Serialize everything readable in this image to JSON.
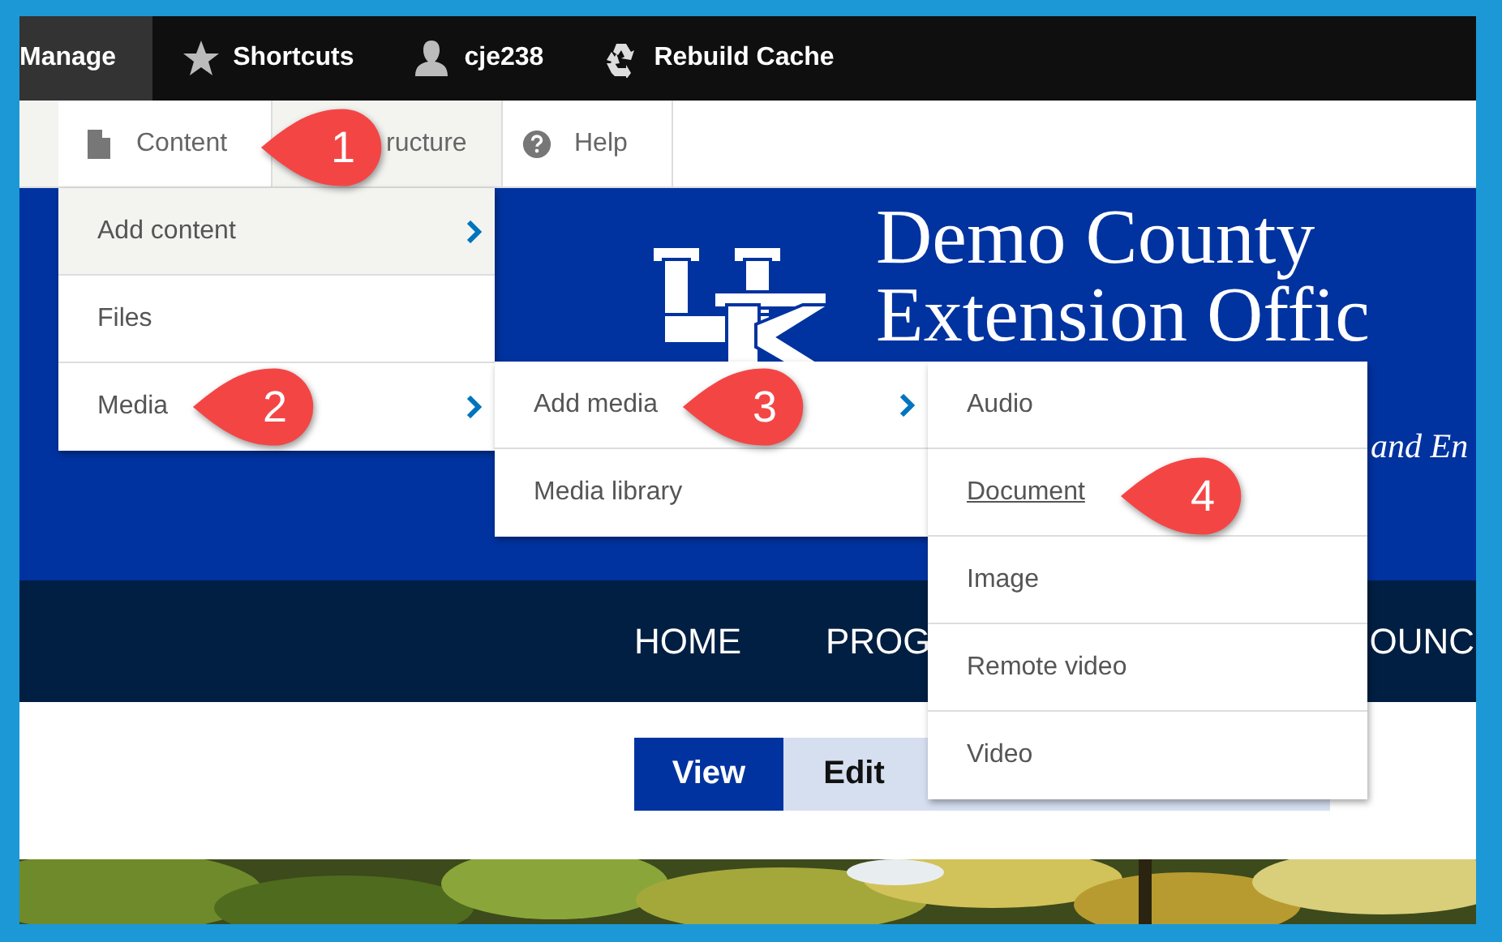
{
  "toolbar": {
    "items": [
      {
        "label": "Manage",
        "selected": true
      },
      {
        "label": "Shortcuts",
        "selected": false
      },
      {
        "label": "cje238",
        "selected": false
      },
      {
        "label": "Rebuild Cache",
        "selected": false
      }
    ]
  },
  "tray": {
    "tabs": [
      {
        "label": "Content",
        "selected": true
      },
      {
        "label": "ructure",
        "selected": false
      },
      {
        "label": "Help",
        "selected": true
      }
    ]
  },
  "header": {
    "title_lines": [
      "Demo County",
      "Extension Offic"
    ],
    "subtitle": "and En"
  },
  "nav": {
    "items": [
      "HOME",
      "PROG",
      "OUNC"
    ]
  },
  "view_tabs": [
    {
      "label": "View",
      "selected": true
    },
    {
      "label": "Edit",
      "selected": false
    }
  ],
  "menus": [
    {
      "items": [
        {
          "label": "Add content",
          "submenu": true,
          "hovered": true,
          "underlined": false
        },
        {
          "label": "Files",
          "submenu": false,
          "hovered": false,
          "underlined": false
        },
        {
          "label": "Media",
          "submenu": true,
          "hovered": false,
          "underlined": false
        }
      ]
    },
    {
      "items": [
        {
          "label": "Add media",
          "submenu": true,
          "hovered": false,
          "underlined": false
        },
        {
          "label": "Media library",
          "submenu": false,
          "hovered": false,
          "underlined": false
        }
      ]
    },
    {
      "items": [
        {
          "label": "Audio",
          "submenu": false,
          "hovered": false,
          "underlined": false
        },
        {
          "label": "Document",
          "submenu": false,
          "hovered": false,
          "underlined": true
        },
        {
          "label": "Image",
          "submenu": false,
          "hovered": false,
          "underlined": false
        },
        {
          "label": "Remote video",
          "submenu": false,
          "hovered": false,
          "underlined": false
        },
        {
          "label": "Video",
          "submenu": false,
          "hovered": false,
          "underlined": false
        }
      ]
    }
  ],
  "callouts": [
    {
      "number": "1"
    },
    {
      "number": "2"
    },
    {
      "number": "3"
    },
    {
      "number": "4"
    }
  ]
}
